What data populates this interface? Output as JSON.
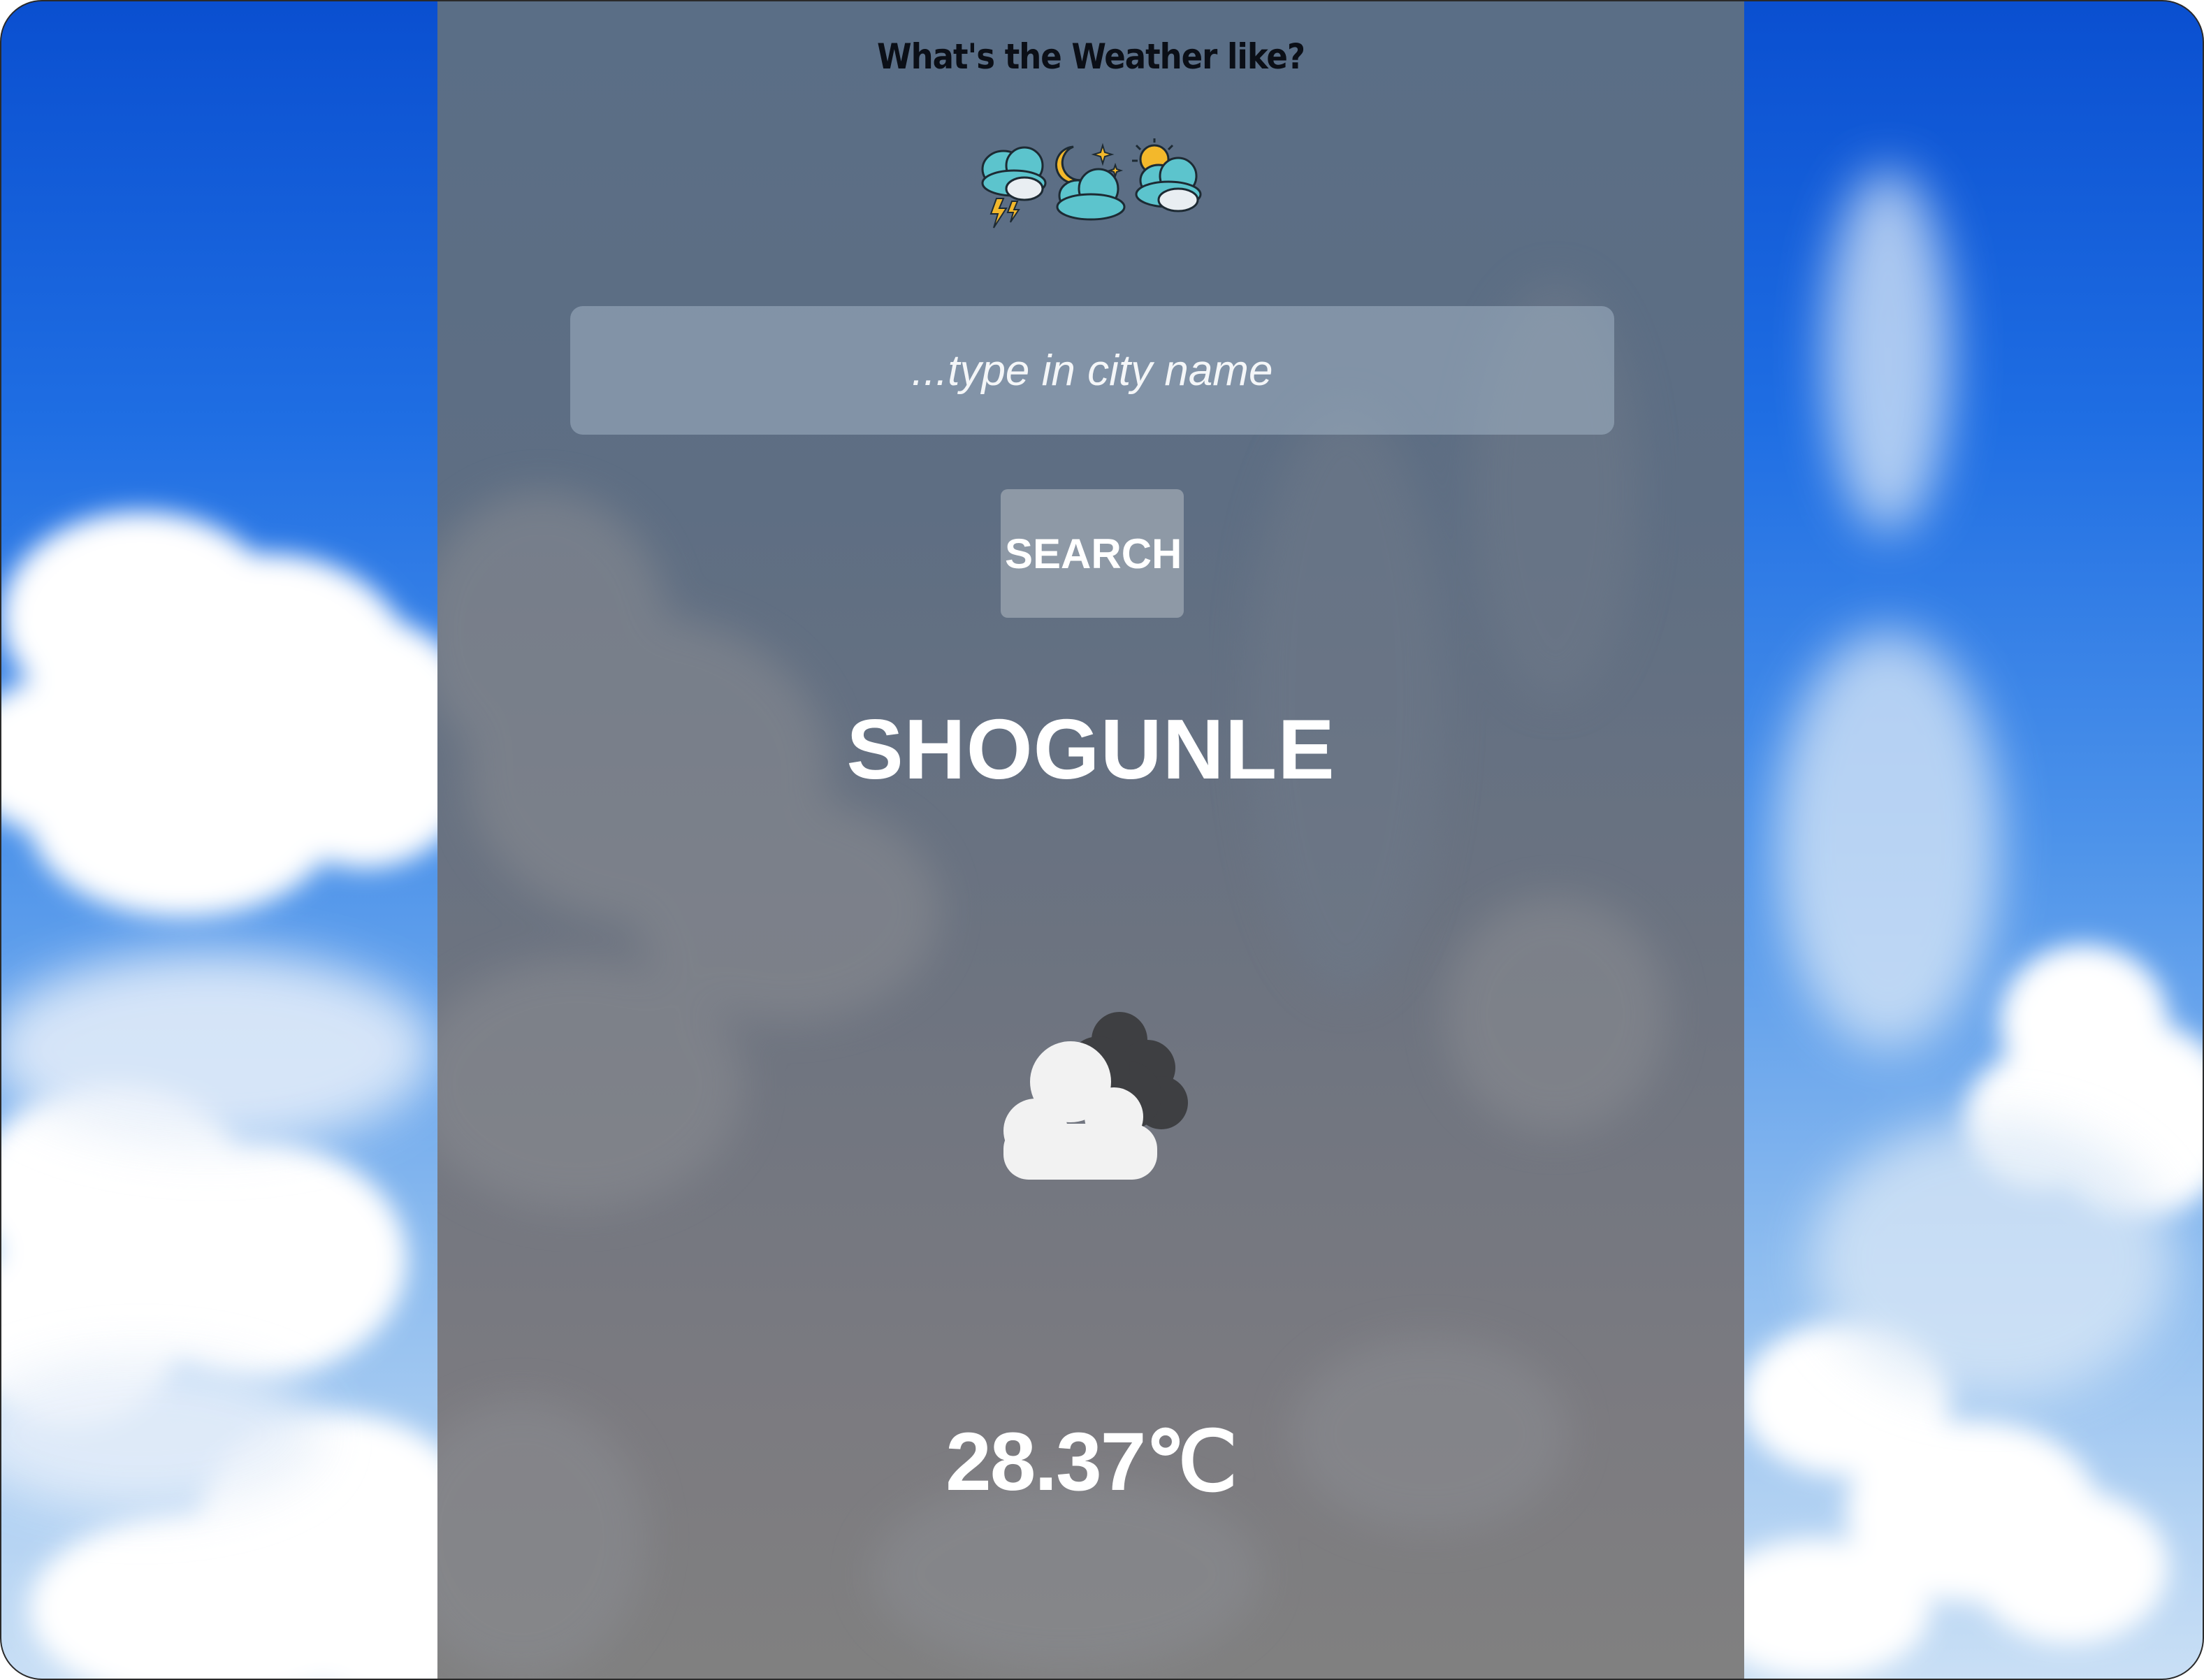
{
  "header": {
    "title": "What's the Weather like?",
    "icons": [
      "thunderstorm-cloud-icon",
      "night-cloud-icon",
      "partly-sunny-cloud-icon"
    ]
  },
  "search": {
    "placeholder": "...type in city name",
    "value": "",
    "button_label": "SEARCH"
  },
  "result": {
    "city": "SHOGUNLE",
    "condition_icon": "cloudy-icon",
    "temperature": "28.37℃"
  },
  "colors": {
    "sky": "#1f6ee3",
    "panel": "#5e6e83",
    "input_bg": "#a0b2c4",
    "button_bg": "#8e99a6",
    "text_light": "#ffffff",
    "title_text": "#0b0f17"
  }
}
